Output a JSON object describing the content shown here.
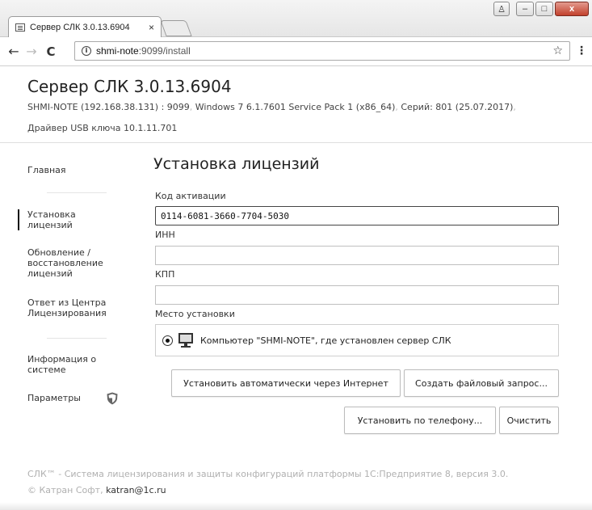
{
  "browser": {
    "tab_title": "Сервер СЛК 3.0.13.6904",
    "tab_close": "×",
    "url_host": "shmi-note",
    "url_path": ":9099/install",
    "star": "☆",
    "menu": "⋮",
    "nav_back": "←",
    "nav_forward": "→",
    "nav_reload": "C",
    "info_glyph": "i",
    "win_user": "♙",
    "win_minimize": "–",
    "win_maximize": "□",
    "win_close": "x"
  },
  "header": {
    "title": "Сервер СЛК 3.0.13.6904",
    "host": "SHMI-NOTE (192.168.38.131) : 9099",
    "os": "Windows 7 6.1.7601 Service Pack 1 (x86_64)",
    "series": "Серий: 801 (25.07.2017)",
    "driver": "Драйвер USB ключа 10.1.11.701",
    "separator": ","
  },
  "sidebar": {
    "items": [
      {
        "label": "Главная"
      },
      {
        "label": "Установка лицензий"
      },
      {
        "label": "Обновление / восстановление лицензий"
      },
      {
        "label": "Ответ из Центра Лицензирования"
      },
      {
        "label": "Информация о системе"
      },
      {
        "label": "Параметры"
      }
    ]
  },
  "main": {
    "title": "Установка лицензий",
    "activation_label": "Код активации",
    "activation_value": "0114-6081-3660-7704-5030",
    "inn_label": "ИНН",
    "inn_value": "",
    "kpp_label": "КПП",
    "kpp_value": "",
    "place_label": "Место установки",
    "place_option": "Компьютер \"SHMI-NOTE\", где установлен сервер СЛК",
    "btn_auto": "Установить автоматически через Интернет",
    "btn_file": "Создать файловый запрос...",
    "btn_phone": "Установить по телефону...",
    "btn_clear": "Очистить"
  },
  "footer": {
    "line1": "СЛК™ - Система лицензирования и защиты конфигураций платформы 1С:Предприятие 8, версия 3.0.",
    "line2_prefix": "© Катран Софт,",
    "email": "katran@1c.ru"
  }
}
